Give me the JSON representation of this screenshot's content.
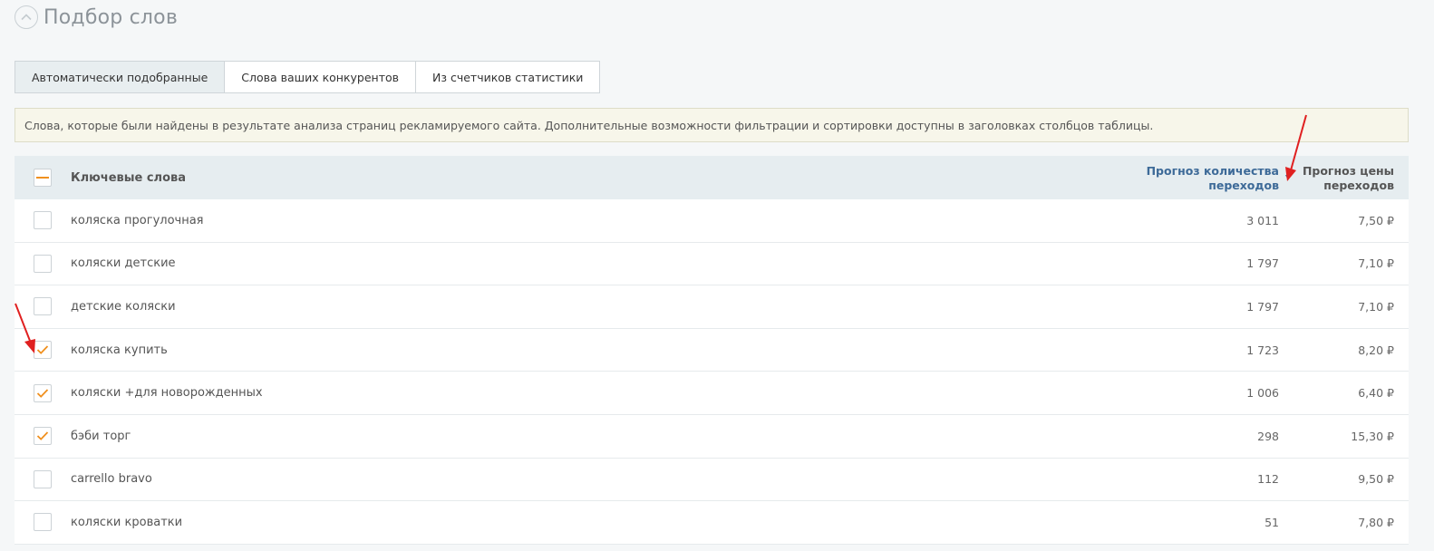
{
  "header": {
    "title": "Подбор слов",
    "collapse_icon": "chevron-up-icon"
  },
  "tabs": [
    {
      "label": "Автоматически подобранные",
      "active": true
    },
    {
      "label": "Слова ваших конкурентов",
      "active": false
    },
    {
      "label": "Из счетчиков статистики",
      "active": false
    }
  ],
  "info": {
    "text": "Слова, которые были найдены в результате анализа страниц рекламируемого сайта. Дополнительные возможности фильтрации и сортировки доступны в заголовках столбцов таблицы."
  },
  "table": {
    "header": {
      "keyword_label": "Ключевые слова",
      "clicks_label_line1": "Прогноз количества",
      "clicks_label_line2": "переходов",
      "price_label_line1": "Прогноз цены",
      "price_label_line2": "переходов",
      "select_all_state": "indeterminate",
      "sort_column": "clicks",
      "sort_direction": "desc"
    },
    "rows": [
      {
        "keyword": "коляска прогулочная",
        "clicks": "3 011",
        "price": "7,50 ₽",
        "checked": false
      },
      {
        "keyword": "коляски детские",
        "clicks": "1 797",
        "price": "7,10 ₽",
        "checked": false
      },
      {
        "keyword": "детские коляски",
        "clicks": "1 797",
        "price": "7,10 ₽",
        "checked": false
      },
      {
        "keyword": "коляска купить",
        "clicks": "1 723",
        "price": "8,20 ₽",
        "checked": true
      },
      {
        "keyword": "коляски +для новорожденных",
        "clicks": "1 006",
        "price": "6,40 ₽",
        "checked": true
      },
      {
        "keyword": "бэби торг",
        "clicks": "298",
        "price": "15,30 ₽",
        "checked": true
      },
      {
        "keyword": "carrello bravo",
        "clicks": "112",
        "price": "9,50 ₽",
        "checked": false
      },
      {
        "keyword": "коляски кроватки",
        "clicks": "51",
        "price": "7,80 ₽",
        "checked": false
      }
    ]
  },
  "colors": {
    "accent": "#f0901e",
    "link": "#3d6a98",
    "annotation_arrow": "#e02020"
  }
}
